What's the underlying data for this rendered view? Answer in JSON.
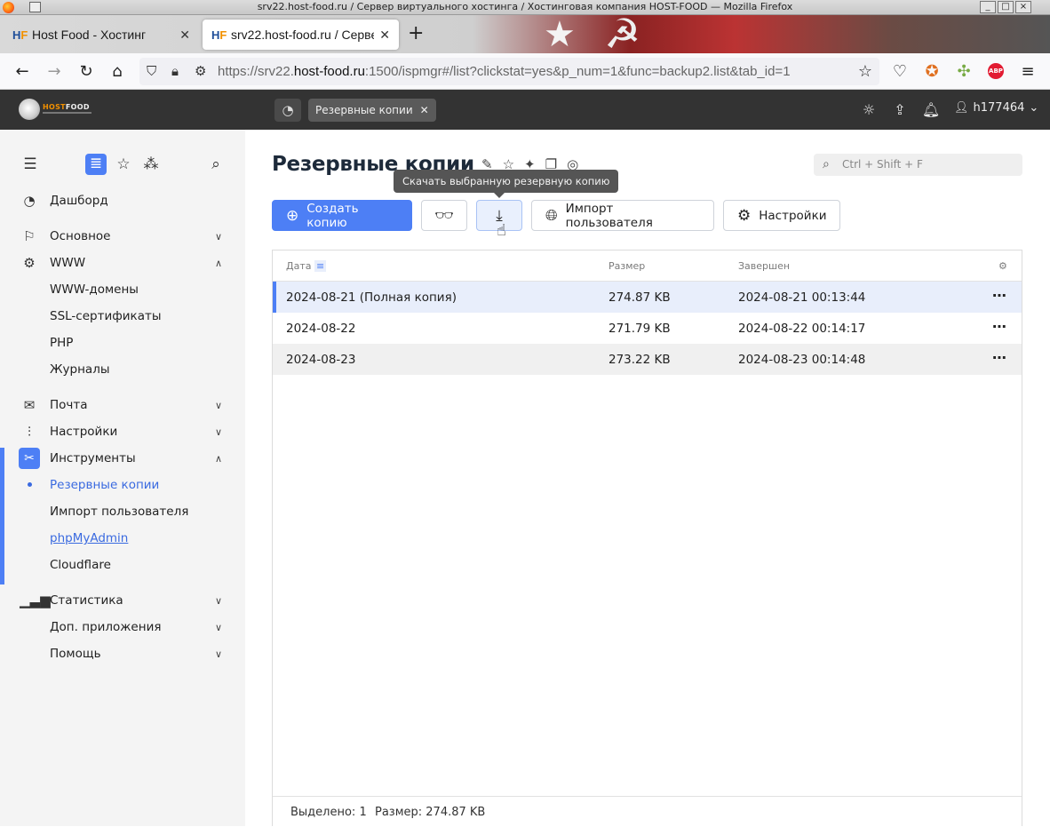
{
  "browser": {
    "window_title": "srv22.host-food.ru / Сервер виртуального хостинга / Хостинговая компания HOST-FOOD — Mozilla Firefox",
    "tabs": [
      {
        "label": "Host Food - Хостинг"
      },
      {
        "label": "srv22.host-food.ru / Серве"
      }
    ],
    "url_prefix": "https://srv22.",
    "url_host": "host-food.ru",
    "url_rest": ":1500/ispmgr#/list?clickstat=yes&p_num=1&func=backup2.list&tab_id=1",
    "abp_label": "ABP"
  },
  "header": {
    "logo_host": "HOST",
    "logo_food": "FOOD",
    "active_chip": "Резервные копии",
    "user": "h177464"
  },
  "sidebar": {
    "items": [
      {
        "label": "Дашборд"
      },
      {
        "label": "Основное"
      },
      {
        "label": "WWW"
      },
      {
        "label": "WWW-домены"
      },
      {
        "label": "SSL-сертификаты"
      },
      {
        "label": "PHP"
      },
      {
        "label": "Журналы"
      },
      {
        "label": "Почта"
      },
      {
        "label": "Настройки"
      },
      {
        "label": "Инструменты"
      },
      {
        "label": "Резервные копии"
      },
      {
        "label": "Импорт пользователя"
      },
      {
        "label": "phpMyAdmin"
      },
      {
        "label": "Cloudflare"
      },
      {
        "label": "Статистика"
      },
      {
        "label": "Доп. приложения"
      },
      {
        "label": "Помощь"
      }
    ]
  },
  "main": {
    "title": "Резервные копии",
    "search_placeholder": "Ctrl + Shift + F",
    "tooltip": "Скачать выбранную резервную копию",
    "buttons": {
      "create": "Создать копию",
      "import": "Импорт пользователя",
      "settings": "Настройки"
    },
    "table": {
      "columns": [
        "Дата",
        "Размер",
        "Завершен"
      ],
      "rows": [
        {
          "date": "2024-08-21 (Полная копия)",
          "size": "274.87 KB",
          "finished": "2024-08-21 00:13:44"
        },
        {
          "date": "2024-08-22",
          "size": "271.79 KB",
          "finished": "2024-08-22 00:14:17"
        },
        {
          "date": "2024-08-23",
          "size": "273.22 KB",
          "finished": "2024-08-23 00:14:48"
        }
      ],
      "footer_selected": "Выделено: 1",
      "footer_size": "Размер: 274.87 KB"
    }
  },
  "colors": {
    "accent": "#4d7ff5",
    "header_bg": "#333333",
    "sidebar_bg": "#f4f4f4"
  }
}
